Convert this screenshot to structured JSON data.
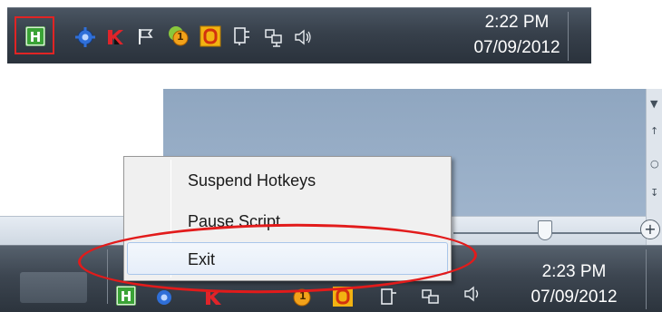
{
  "top_tray": {
    "time": "2:22 PM",
    "date": "07/09/2012",
    "icons": [
      "autohotkey-icon",
      "gear-icon",
      "kaspersky-icon",
      "flag-icon",
      "update-badge-icon",
      "office-icon",
      "power-plug-icon",
      "network-icon",
      "speaker-icon"
    ],
    "update_badge_count": "1"
  },
  "context_menu": {
    "items": [
      {
        "label": "Suspend Hotkeys"
      },
      {
        "label": "Pause Script"
      },
      {
        "label": "Exit"
      }
    ]
  },
  "bottom_tray": {
    "time": "2:23 PM",
    "date": "07/09/2012",
    "update_badge_count": "1"
  },
  "zoom": {
    "plus_label": "+"
  },
  "colors": {
    "annotation_red": "#e21b1b",
    "autohotkey_green": "#3aa336",
    "menu_highlight_border": "#a9c6ea"
  }
}
